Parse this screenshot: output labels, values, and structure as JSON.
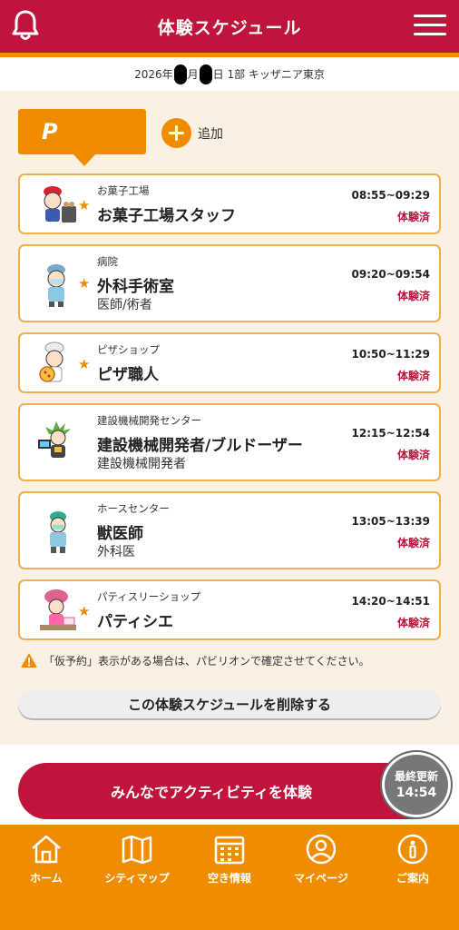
{
  "header": {
    "title": "体験スケジュール",
    "bell_icon": "bell-icon",
    "menu_icon": "hamburger-menu-icon"
  },
  "datebar": {
    "prefix": "2026年",
    "month_suffix": "月",
    "day_suffix": "日 1部 キッザニア東京"
  },
  "player": {
    "letter": "P",
    "add_label": "追加"
  },
  "schedule": [
    {
      "pavilion": "お菓子工場",
      "job": "お菓子工場スタッフ",
      "sub": "",
      "time": "08:55~09:29",
      "status": "体験済",
      "starred": true
    },
    {
      "pavilion": "病院",
      "job": "外科手術室",
      "sub": "医師/術者",
      "time": "09:20~09:54",
      "status": "体験済",
      "starred": true
    },
    {
      "pavilion": "ピザショップ",
      "job": "ピザ職人",
      "sub": "",
      "time": "10:50~11:29",
      "status": "体験済",
      "starred": true
    },
    {
      "pavilion": "建設機械開発センター",
      "job": "建設機械開発者/ブルドーザー",
      "sub": "建設機械開発者",
      "time": "12:15~12:54",
      "status": "体験済",
      "starred": false
    },
    {
      "pavilion": "ホースセンター",
      "job": "獣医師",
      "sub": "外科医",
      "time": "13:05~13:39",
      "status": "体験済",
      "starred": false
    },
    {
      "pavilion": "パティスリーショップ",
      "job": "パティシエ",
      "sub": "",
      "time": "14:20~14:51",
      "status": "体験済",
      "starred": true
    }
  ],
  "notice": "「仮予約」表示がある場合は、パビリオンで確定させてください。",
  "delete_button": "この体験スケジュールを削除する",
  "activity_button": "みんなでアクティビティを体験",
  "update_badge": {
    "label": "最終更新",
    "time": "14:54"
  },
  "bottom_nav": [
    {
      "label": "ホーム",
      "icon": "home-icon"
    },
    {
      "label": "シティマップ",
      "icon": "map-icon"
    },
    {
      "label": "空き情報",
      "icon": "calendar-icon"
    },
    {
      "label": "マイページ",
      "icon": "user-icon"
    },
    {
      "label": "ご案内",
      "icon": "info-icon"
    }
  ],
  "colors": {
    "brand_red": "#c0143c",
    "brand_orange": "#f08c00",
    "background": "#fbf0e4"
  }
}
